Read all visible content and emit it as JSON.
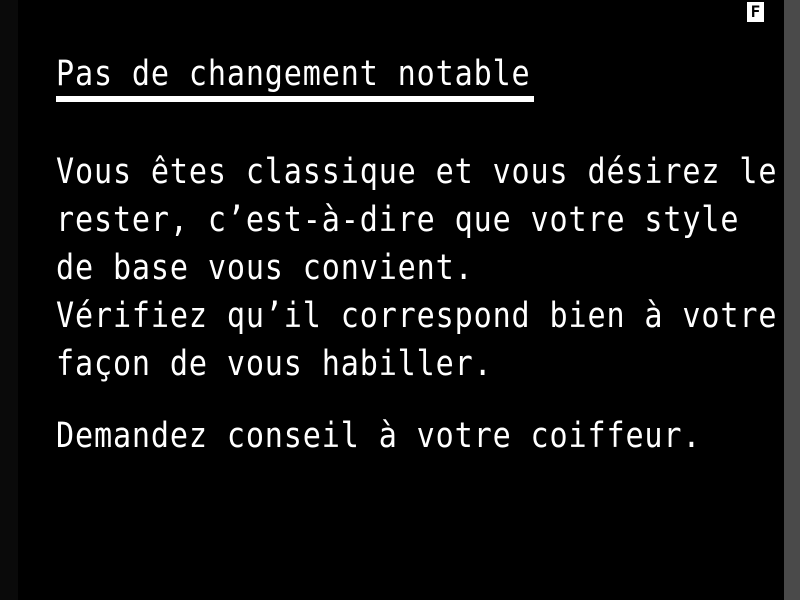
{
  "indicator": {
    "label": "F"
  },
  "title": "Pas de changement notable",
  "body_lines": [
    "Vous êtes classique et vous désirez le",
    "rester, c’est-à-dire que votre style",
    "de base vous convient.",
    "Vérifiez qu’il correspond bien à votre",
    "façon de vous habiller."
  ],
  "advice": "Demandez conseil à votre coiffeur.",
  "colors": {
    "background": "#000000",
    "text": "#ffffff",
    "right_border": "#4a4a4a"
  }
}
